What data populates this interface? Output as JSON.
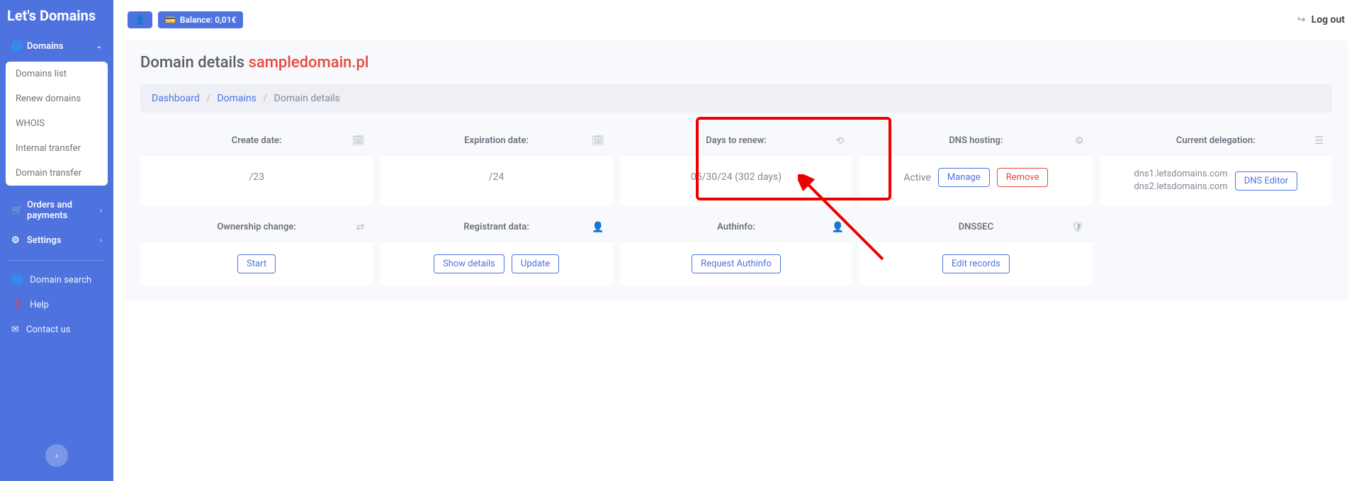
{
  "brand": "Let's Domains",
  "topbar": {
    "balance_label": "Balance: 0,01€",
    "logout": "Log out"
  },
  "sidebar": {
    "domains_label": "Domains",
    "domains_sub": [
      "Domains list",
      "Renew domains",
      "WHOIS",
      "Internal transfer",
      "Domain transfer"
    ],
    "orders_label": "Orders and payments",
    "settings_label": "Settings",
    "secondary": [
      "Domain search",
      "Help",
      "Contact us"
    ]
  },
  "page": {
    "title_prefix": "Domain details ",
    "domain_name": "sampledomain.pl",
    "breadcrumb": {
      "dashboard": "Dashboard",
      "domains": "Domains",
      "current": "Domain details"
    }
  },
  "cards": {
    "create": {
      "title": "Create date:",
      "value": "/23"
    },
    "expire": {
      "title": "Expiration date:",
      "value": "/24"
    },
    "renew": {
      "title": "Days to renew:",
      "value": "05/30/24 (302 days)"
    },
    "dns": {
      "title": "DNS hosting:",
      "status": "Active",
      "manage": "Manage",
      "remove": "Remove"
    },
    "deleg": {
      "title": "Current delegation:",
      "ns1": "dns1.letsdomains.com",
      "ns2": "dns2.letsdomains.com",
      "editor": "DNS Editor"
    },
    "owner": {
      "title": "Ownership change:",
      "start": "Start"
    },
    "reg": {
      "title": "Registrant data:",
      "show": "Show details",
      "update": "Update"
    },
    "auth": {
      "title": "Authinfo:",
      "request": "Request Authinfo"
    },
    "dnssec": {
      "title": "DNSSEC",
      "edit": "Edit records"
    }
  }
}
